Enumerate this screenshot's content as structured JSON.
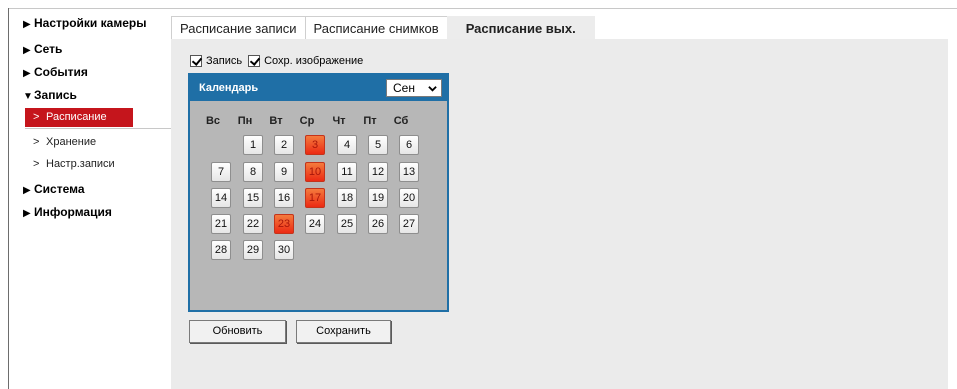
{
  "sidebar": {
    "items": [
      {
        "label": "Настройки камеры",
        "expanded": false
      },
      {
        "label": "Сеть",
        "expanded": false
      },
      {
        "label": "События",
        "expanded": false
      },
      {
        "label": "Запись",
        "expanded": true
      },
      {
        "label": "Система",
        "expanded": false
      },
      {
        "label": "Информация",
        "expanded": false
      }
    ],
    "sub_items": [
      {
        "label": "Расписание",
        "active": true
      },
      {
        "label": "Хранение",
        "active": false
      },
      {
        "label": "Настр.записи",
        "active": false
      }
    ],
    "arrow_collapsed": "▶",
    "arrow_expanded": "▼",
    "sub_chevron": ">"
  },
  "tabs": [
    {
      "label": "Расписание записи",
      "active": false
    },
    {
      "label": "Расписание снимков",
      "active": false
    },
    {
      "label": "Расписание вых.",
      "active": true
    }
  ],
  "checkboxes": [
    {
      "label": "Запись",
      "checked": true
    },
    {
      "label": "Сохр. изображение",
      "checked": true
    }
  ],
  "calendar": {
    "title": "Календарь",
    "month": "Сен",
    "weekdays": [
      "Вс",
      "Пн",
      "Вт",
      "Ср",
      "Чт",
      "Пт",
      "Сб"
    ],
    "first_day_offset": 1,
    "days_in_month": 30,
    "marked_days": [
      3,
      10,
      17,
      23
    ]
  },
  "buttons": {
    "refresh": "Обновить",
    "save": "Сохранить"
  },
  "colors": {
    "accent_red": "#c5151c",
    "calendar_blue": "#1f6fa6",
    "marked_day": "#ec2a13"
  }
}
